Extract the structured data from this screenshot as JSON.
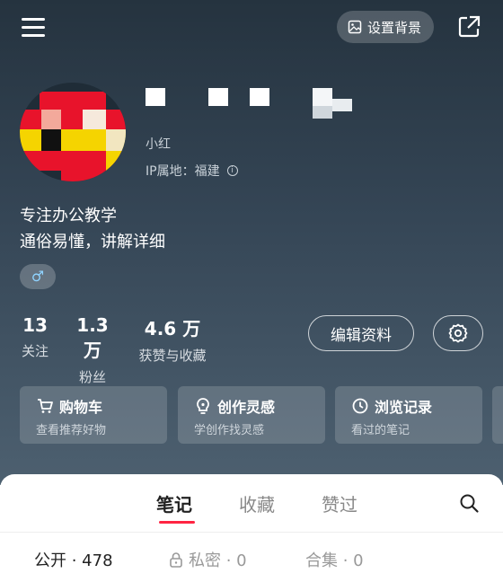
{
  "header": {
    "set_background_label": "设置背景"
  },
  "profile": {
    "id_text": "小红",
    "ip_location": "IP属地：福建",
    "bio_lines": [
      "专注办公教学",
      "通俗易懂，讲解详细"
    ],
    "gender_symbol": "♂",
    "gender_color": "#8fd3ff"
  },
  "stats": [
    {
      "value": "13",
      "label": "关注"
    },
    {
      "value": "1.3 万",
      "label": "粉丝"
    },
    {
      "value": "4.6 万",
      "label": "获赞与收藏"
    }
  ],
  "actions": {
    "edit_label": "编辑资料"
  },
  "cards": [
    {
      "title": "购物车",
      "subtitle": "查看推荐好物",
      "icon": "cart-icon"
    },
    {
      "title": "创作灵感",
      "subtitle": "学创作找灵感",
      "icon": "bulb-icon"
    },
    {
      "title": "浏览记录",
      "subtitle": "看过的笔记",
      "icon": "clock-icon"
    }
  ],
  "tabs": [
    {
      "label": "笔记",
      "active": true
    },
    {
      "label": "收藏",
      "active": false
    },
    {
      "label": "赞过",
      "active": false
    }
  ],
  "filters": [
    {
      "label": "公开 · 478",
      "active": true
    },
    {
      "label": "私密 · 0",
      "active": false,
      "icon": "lock-icon"
    },
    {
      "label": "合集 · 0",
      "active": false
    }
  ],
  "colors": {
    "accent": "#ff2442",
    "hero_top": "#25333f",
    "hero_bottom": "#4d6070"
  }
}
